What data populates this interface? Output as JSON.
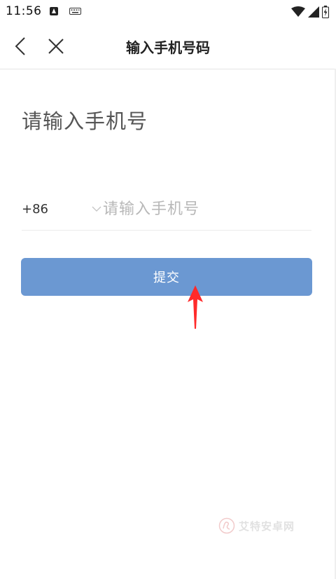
{
  "status_bar": {
    "time": "11:56",
    "icons": [
      "android-notification-icon",
      "keyboard-icon",
      "wifi-icon",
      "signal-icon",
      "battery-charging-icon"
    ]
  },
  "nav": {
    "title": "输入手机号码",
    "back_icon": "chevron-left-icon",
    "close_icon": "close-icon"
  },
  "main": {
    "heading": "请输入手机号",
    "country_code": "+86",
    "phone_input": {
      "value": "",
      "placeholder": "请输入手机号"
    },
    "submit_label": "提交"
  },
  "annotation": {
    "icon": "red-arrow-icon",
    "color": "#ff2a2a"
  },
  "watermark": {
    "text": "艾特安卓网"
  },
  "colors": {
    "button": "#6b98d2",
    "placeholder": "#b8b8b8"
  }
}
